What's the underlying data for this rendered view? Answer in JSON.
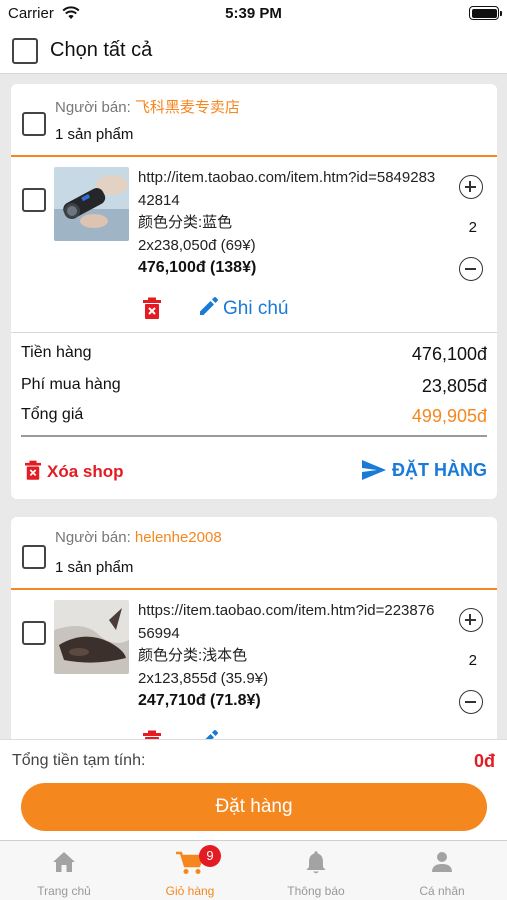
{
  "status_bar": {
    "carrier": "Carrier",
    "time": "5:39 PM"
  },
  "header": {
    "select_all_label": "Chọn tất cả"
  },
  "shops": [
    {
      "seller_label": "Người bán: ",
      "seller_name": "飞科黑麦专卖店",
      "product_count": "1 sản phẩm",
      "item": {
        "link": "http://item.taobao.com/item.htm?id=584928342814",
        "variant": "颜色分类:蓝色",
        "unit_price": "2x238,050đ (69¥)",
        "line_total": "476,100đ (138¥)",
        "quantity": "2"
      },
      "note_label": "Ghi chú",
      "summary": [
        {
          "label": "Tiền hàng",
          "value": "476,100đ"
        },
        {
          "label": "Phí mua hàng",
          "value": "23,805đ"
        },
        {
          "label": "Tổng giá",
          "value": "499,905đ"
        }
      ],
      "delete_shop_label": "Xóa shop",
      "place_order_label": "ĐẶT HÀNG"
    },
    {
      "seller_label": "Người bán: ",
      "seller_name": "helenhe2008",
      "product_count": "1 sản phẩm",
      "item": {
        "link": "https://item.taobao.com/item.htm?id=22387656994",
        "variant": "颜色分类:浅本色",
        "unit_price": "2x123,855đ (35.9¥)",
        "line_total": "247,710đ (71.8¥)",
        "quantity": "2"
      }
    }
  ],
  "footer": {
    "total_label": "Tổng tiền tạm tính:",
    "total_value": "0đ",
    "order_button_label": "Đặt hàng"
  },
  "tab_bar": {
    "tabs": [
      {
        "label": "Trang chủ",
        "icon": "home-icon",
        "active": false
      },
      {
        "label": "Giỏ hàng",
        "icon": "cart-icon",
        "active": true,
        "badge": "9"
      },
      {
        "label": "Thông báo",
        "icon": "bell-icon",
        "active": false
      },
      {
        "label": "Cá nhân",
        "icon": "person-icon",
        "active": false
      }
    ]
  },
  "colors": {
    "accent": "#f5871f",
    "link": "#1a7ad8",
    "danger": "#e31c23"
  }
}
